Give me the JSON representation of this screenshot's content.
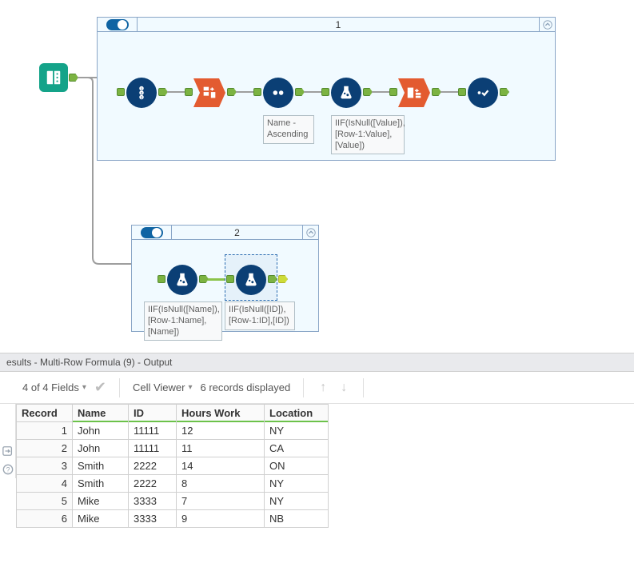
{
  "containers": {
    "c1": {
      "title": "1"
    },
    "c2": {
      "title": "2"
    }
  },
  "annotations": {
    "sort": "Name - Ascending",
    "mrf1": "IIF(IsNull([Value]),[Row-1:Value],[Value])",
    "mrf_name": "IIF(IsNull([Name]),[Row-1:Name],[Name])",
    "mrf_id": "IIF(IsNull([ID]),[Row-1:ID],[ID])"
  },
  "results": {
    "title": "esults - Multi-Row Formula (9) - Output",
    "fields": "4 of 4 Fields",
    "viewer": "Cell Viewer",
    "recinfo": "6 records displayed",
    "columns": [
      "Record",
      "Name",
      "ID",
      "Hours Work",
      "Location"
    ],
    "rows": [
      {
        "n": 1,
        "Name": "John",
        "ID": "11111",
        "Hours Work": "12",
        "Location": "NY"
      },
      {
        "n": 2,
        "Name": "John",
        "ID": "11111",
        "Hours Work": "11",
        "Location": "CA"
      },
      {
        "n": 3,
        "Name": "Smith",
        "ID": "2222",
        "Hours Work": "14",
        "Location": "ON"
      },
      {
        "n": 4,
        "Name": "Smith",
        "ID": "2222",
        "Hours Work": "8",
        "Location": "NY"
      },
      {
        "n": 5,
        "Name": "Mike",
        "ID": "3333",
        "Hours Work": "7",
        "Location": "NY"
      },
      {
        "n": 6,
        "Name": "Mike",
        "ID": "3333",
        "Hours Work": "9",
        "Location": "NB"
      }
    ]
  }
}
